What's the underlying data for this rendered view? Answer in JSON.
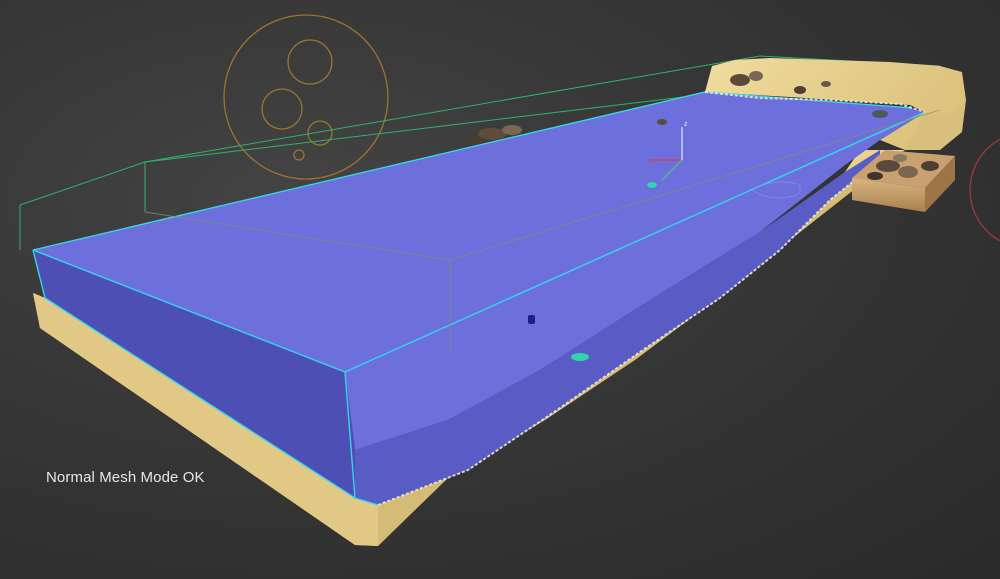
{
  "viewport": {
    "status_text": "Normal Mesh Mode OK"
  },
  "scene": {
    "objects": [
      "sand-terrain",
      "water-volume",
      "rock-cluster",
      "wooden-crate",
      "particle-emitter-helper",
      "transform-gizmo",
      "bounding-box"
    ]
  },
  "colors": {
    "background": "#2c2c2c",
    "water_top": "#6c6fdc",
    "water_front": "#4e4fb4",
    "water_edge": "#33d7ea",
    "sand": "#e6cf8a",
    "sand_shadow": "#c6ad6a",
    "bounding_box": "#2fb36a",
    "emitter_helper": "#9a7530",
    "gizmo_x": "#e23a3a",
    "gizmo_y": "#3ad27a",
    "gizmo_z": "#e8e8e8"
  }
}
